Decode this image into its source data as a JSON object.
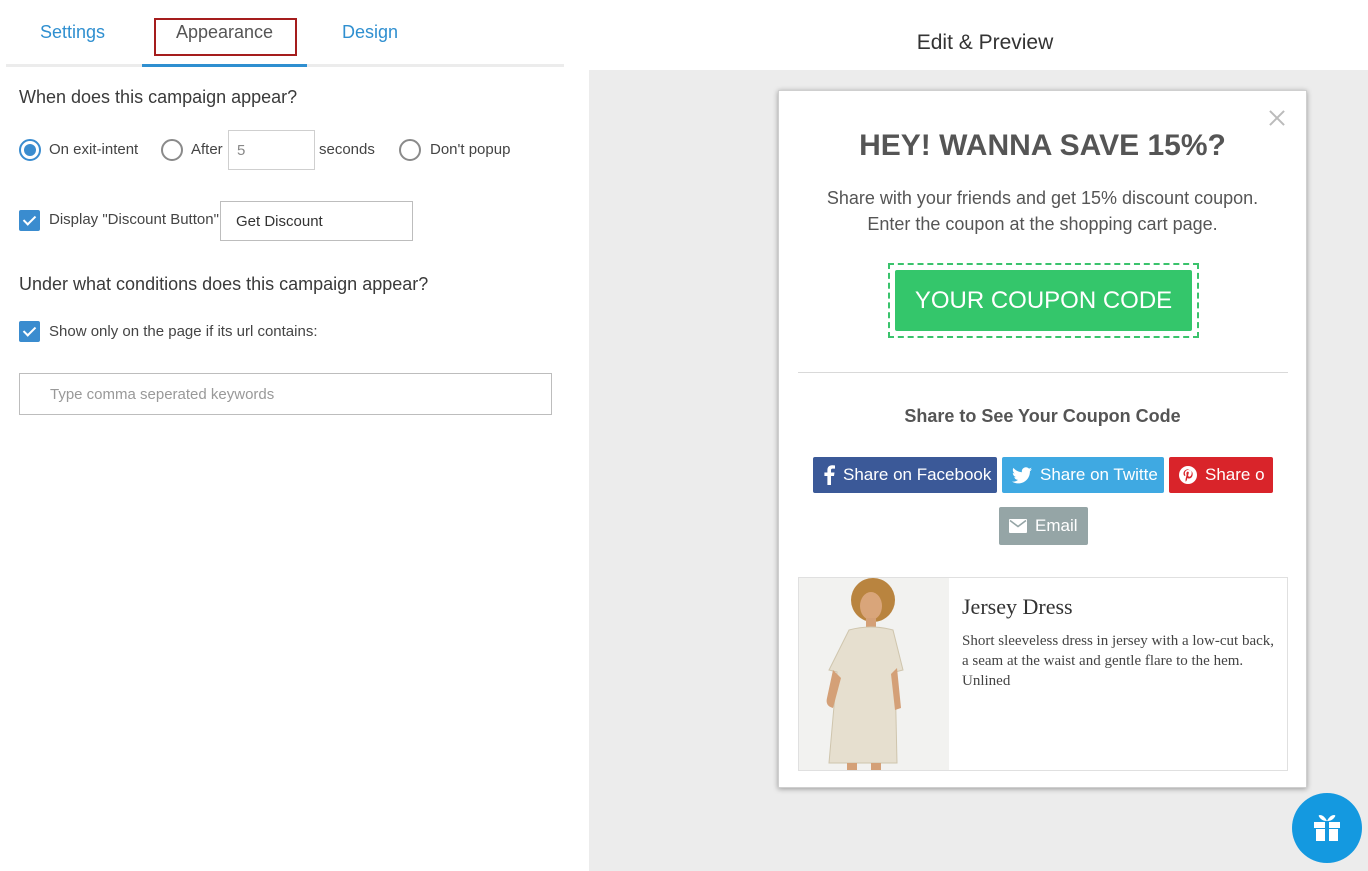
{
  "tabs": {
    "settings": "Settings",
    "appearance": "Appearance",
    "design": "Design"
  },
  "appearance": {
    "when_question": "When does this campaign appear?",
    "options": {
      "exit_intent": "On exit-intent",
      "after": "After",
      "after_seconds_value": "5",
      "seconds": "seconds",
      "dont_popup": "Don't popup"
    },
    "display_discount_label": "Display \"Discount Button\"",
    "discount_button_value": "Get Discount",
    "conditions_question": "Under what conditions does this campaign appear?",
    "url_contains_label": "Show only on the page if its url contains:",
    "keywords_placeholder": "Type comma seperated keywords"
  },
  "preview": {
    "title": "Edit & Preview",
    "headline": "HEY! WANNA SAVE 15%?",
    "subtext_line1": "Share with your friends and get 15% discount coupon.",
    "subtext_line2": "Enter the coupon at the shopping cart page.",
    "coupon_label": "YOUR COUPON CODE",
    "share_title": "Share to See Your Coupon Code",
    "share_buttons": {
      "facebook": "Share on Facebook",
      "twitter": "Share on Twitte",
      "pinterest": "Share o",
      "email": "Email"
    },
    "product": {
      "name": "Jersey Dress",
      "description": "Short sleeveless dress in jersey with a low-cut back, a seam at the waist and gentle flare to the hem. Unlined"
    }
  },
  "colors": {
    "accent": "#2f8fd0",
    "coupon_green": "#34c66b",
    "facebook": "#3b5998",
    "twitter": "#3fa9e2",
    "pinterest": "#d9242a",
    "email": "#95a5a6",
    "gift_button": "#1499e0"
  },
  "icons": [
    "facebook-icon",
    "twitter-icon",
    "pinterest-icon",
    "email-icon",
    "gift-icon",
    "close-icon"
  ]
}
